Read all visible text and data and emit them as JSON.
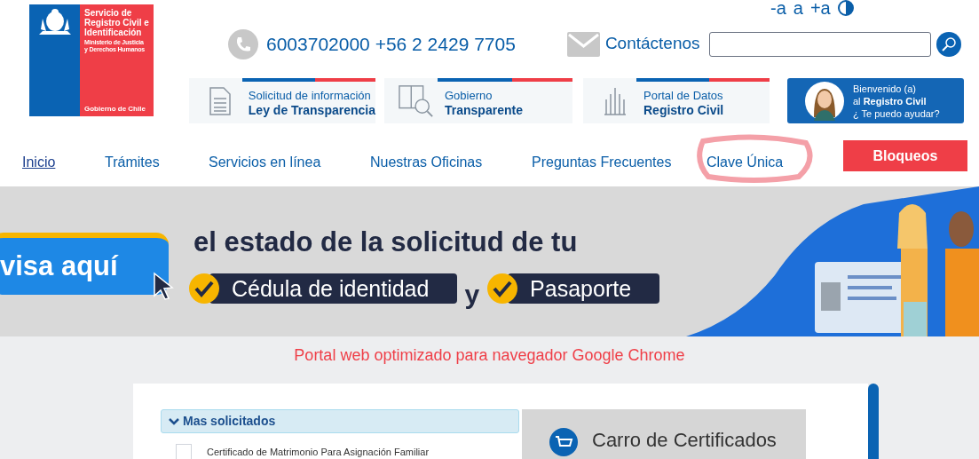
{
  "logo": {
    "title_lines": [
      "Servicio de",
      "Registro Civil e",
      "Identificación"
    ],
    "ministry_lines": [
      "Ministerio de Justicia",
      "y Derechos Humanos"
    ],
    "footer": "Gobierno de Chile"
  },
  "font_controls": [
    "-a",
    "a",
    "+a"
  ],
  "phone": "6003702000 +56 2 2429 7705",
  "contact": "Contáctenos",
  "quick_links": [
    {
      "kind": "document",
      "line1": "Solicitud de información",
      "line2": "Ley de Transparencia"
    },
    {
      "kind": "magnifier",
      "line1": "Gobierno",
      "line2": "Transparente"
    },
    {
      "kind": "chart",
      "line1": "Portal de Datos",
      "line2": "Registro Civil"
    }
  ],
  "assistant": {
    "lines": [
      "Bienvenido (a)",
      "al **Registro Civil**",
      "¿ Te puedo ayudar?"
    ]
  },
  "nav": [
    {
      "label": "Inicio",
      "selected": true,
      "highlighted": false
    },
    {
      "label": "Trámites",
      "selected": false,
      "highlighted": false
    },
    {
      "label": "Servicios en línea",
      "selected": false,
      "highlighted": false
    },
    {
      "label": "Nuestras Oficinas",
      "selected": false,
      "highlighted": false
    },
    {
      "label": "Preguntas Frecuentes",
      "selected": false,
      "highlighted": false
    },
    {
      "label": "Clave Única",
      "selected": false,
      "highlighted": true
    }
  ],
  "block_button": "Bloqueos",
  "banner": {
    "button": "visa aquí",
    "headline": "el estado de la solicitud de tu",
    "options": [
      "Cédula de identidad",
      "Pasaporte"
    ],
    "joiner": "y"
  },
  "notice": "Portal web optimizado para navegador Google Chrome",
  "section": {
    "title": "Mas solicitados",
    "expanded": true,
    "items": [
      {
        "label": "Certificado de Matrimonio Para Asignación Familiar",
        "checked": false
      }
    ]
  },
  "cart": {
    "title": "Carro de Certificados"
  }
}
